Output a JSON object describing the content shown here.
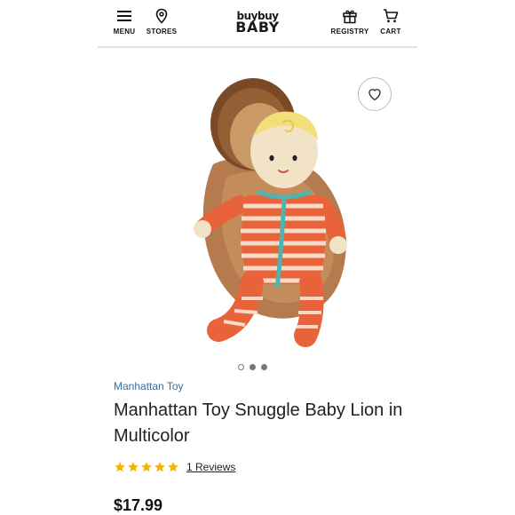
{
  "header": {
    "menu_label": "MENU",
    "stores_label": "STORES",
    "logo_top": "buybuy",
    "logo_bottom": "BABY",
    "registry_label": "REGISTRY",
    "cart_label": "CART"
  },
  "product": {
    "brand": "Manhattan Toy",
    "title": "Manhattan Toy Snuggle Baby Lion in Multicolor",
    "rating": 5,
    "rating_max": 5,
    "reviews_link": "1 Reviews",
    "price": "$17.99",
    "image_count": 3,
    "active_image": 1
  },
  "colors": {
    "brand_link": "#2f6fa6",
    "star": "#f5b301"
  },
  "icons": {
    "menu": "hamburger-icon",
    "stores": "map-pin-icon",
    "registry": "gift-icon",
    "cart": "cart-icon",
    "favorite": "heart-icon"
  }
}
